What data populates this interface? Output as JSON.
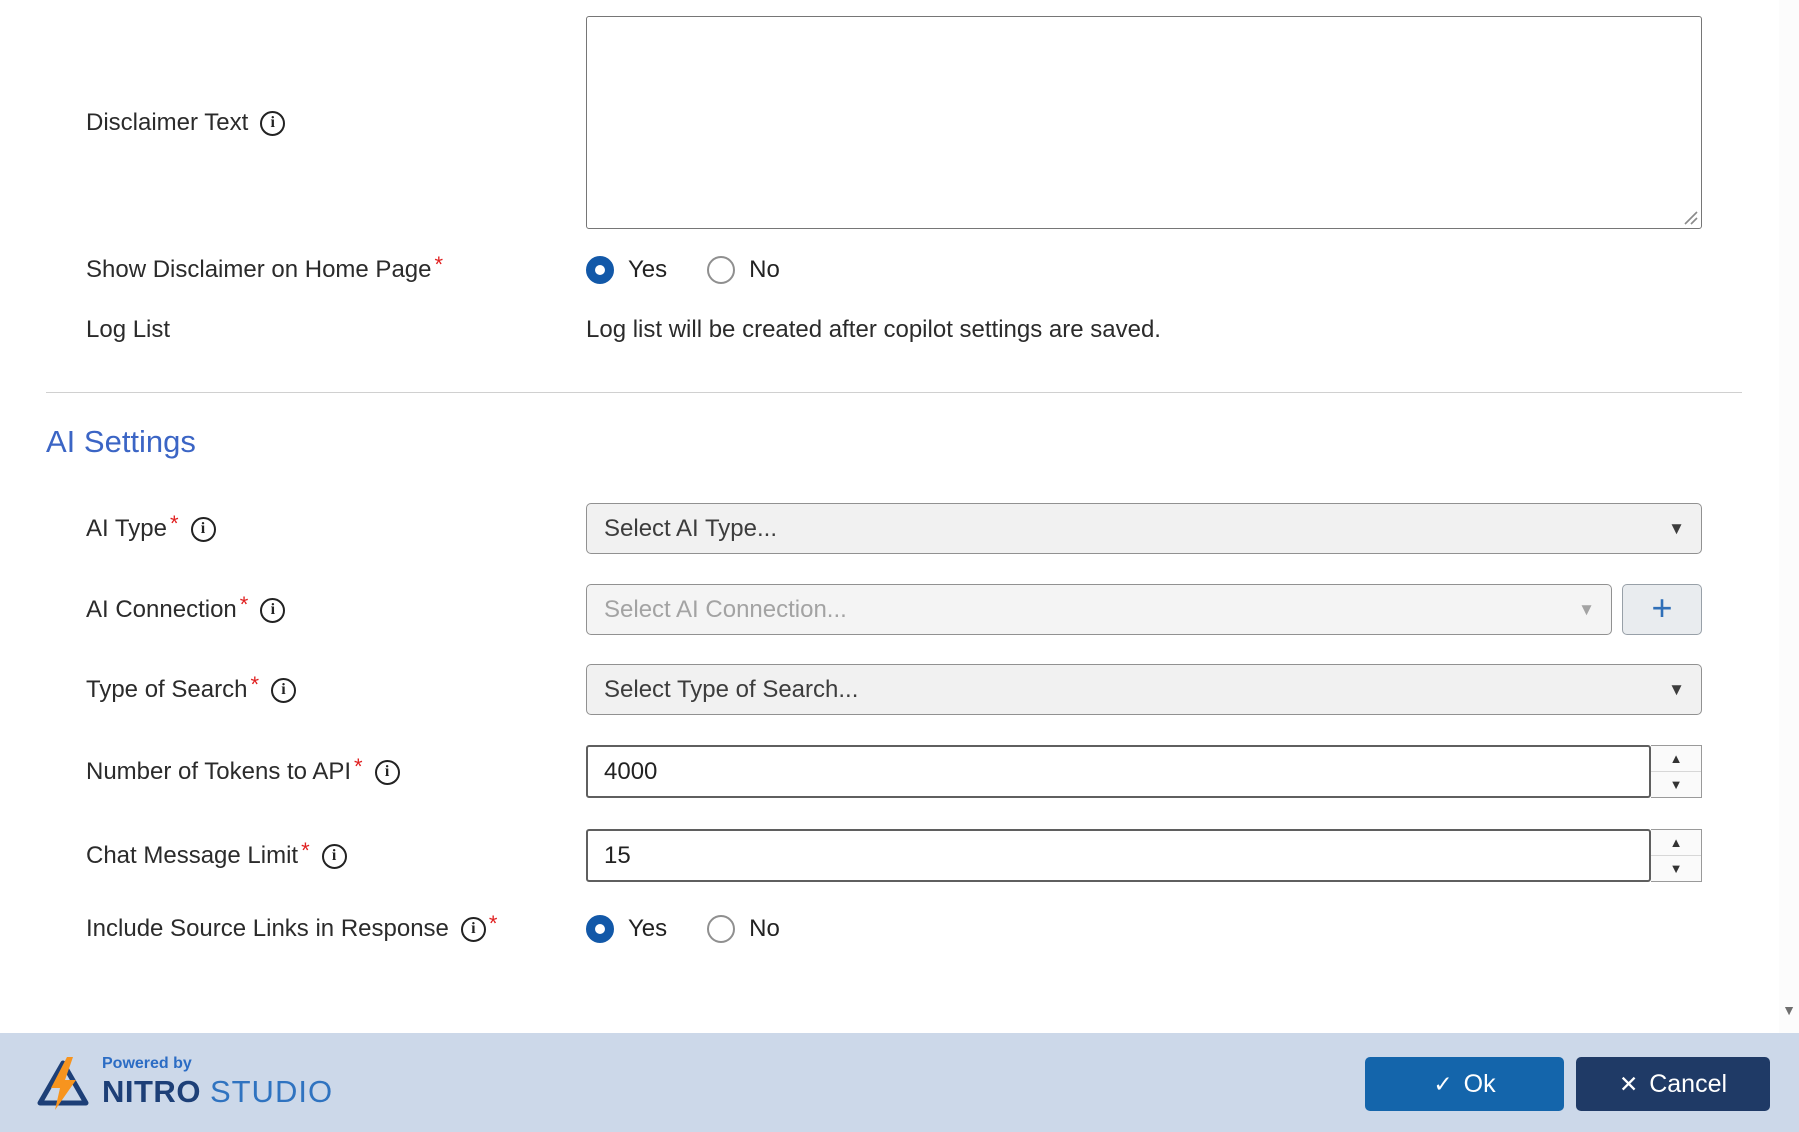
{
  "icons": {
    "info": "i",
    "dropdown_arrow": "▼",
    "plus": "+",
    "check": "✓",
    "close": "✕",
    "spin_up": "▲",
    "spin_down": "▼",
    "scroll_down": "▼"
  },
  "misc": {
    "required_marker": "*"
  },
  "form": {
    "disclaimer_text": {
      "label": "Disclaimer Text",
      "value": ""
    },
    "show_disclaimer": {
      "label": "Show Disclaimer on Home Page",
      "options": {
        "yes": "Yes",
        "no": "No"
      },
      "selected": "Yes"
    },
    "log_list": {
      "label": "Log List",
      "message": "Log list will be created after copilot settings are saved."
    }
  },
  "ai_settings": {
    "heading": "AI Settings",
    "ai_type": {
      "label": "AI Type",
      "selected_value": "Select AI Type..."
    },
    "ai_connection": {
      "label": "AI Connection",
      "selected_value": "Select AI Connection..."
    },
    "type_of_search": {
      "label": "Type of Search",
      "selected_value": "Select Type of Search..."
    },
    "tokens_to_api": {
      "label": "Number of Tokens to API",
      "value": "4000"
    },
    "chat_message_limit": {
      "label": "Chat Message Limit",
      "value": "15"
    },
    "include_source_links": {
      "label": "Include Source Links in Response",
      "options": {
        "yes": "Yes",
        "no": "No"
      },
      "selected": "Yes"
    }
  },
  "footer": {
    "powered_by": "Powered by",
    "brand_name": "NITRO",
    "brand_suffix": "STUDIO",
    "ok_button": "Ok",
    "cancel_button": "Cancel"
  },
  "colors": {
    "accent_blue": "#1258a8",
    "heading_blue": "#3b65c5",
    "required_red": "#e01f1f",
    "footer_bg": "#ccd8e9",
    "ok_button_bg": "#1465ab",
    "cancel_button_bg": "#1f3a66",
    "brand_dark": "#1d3f77",
    "brand_light": "#2f73c0",
    "bolt_orange": "#f7941e"
  }
}
